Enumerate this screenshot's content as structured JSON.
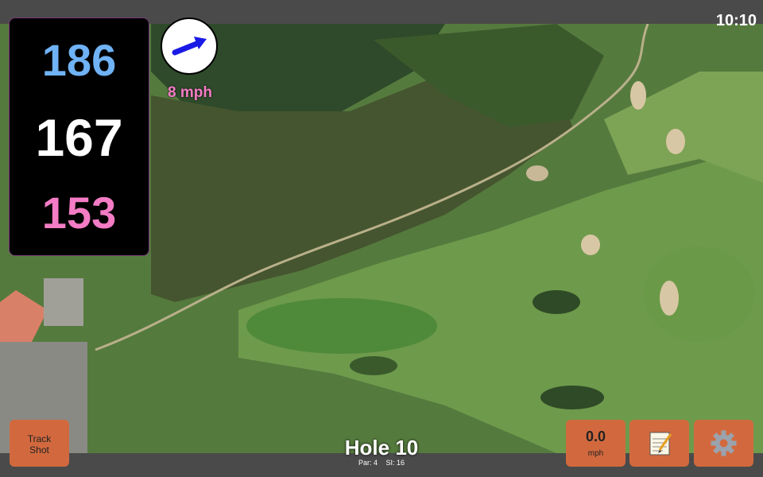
{
  "status": {
    "time": "10:10"
  },
  "distances": {
    "back": "186",
    "middle": "167",
    "front": "153"
  },
  "wind": {
    "speed_text": "8 mph",
    "direction_icon": "wind-arrow-icon",
    "arrow_color": "#1a1ae6"
  },
  "buttons": {
    "track_shot": "Track\nShot",
    "wind_value": "0.0",
    "wind_unit": "mph",
    "notes_icon": "notepad-icon",
    "settings_icon": "gear-icon"
  },
  "hole": {
    "title": "Hole 10",
    "par": "Par: 4",
    "si": "SI: 16"
  },
  "colors": {
    "back": "#6fb2f5",
    "middle": "#ffffff",
    "front": "#f37cc4",
    "button": "#d2693e"
  }
}
